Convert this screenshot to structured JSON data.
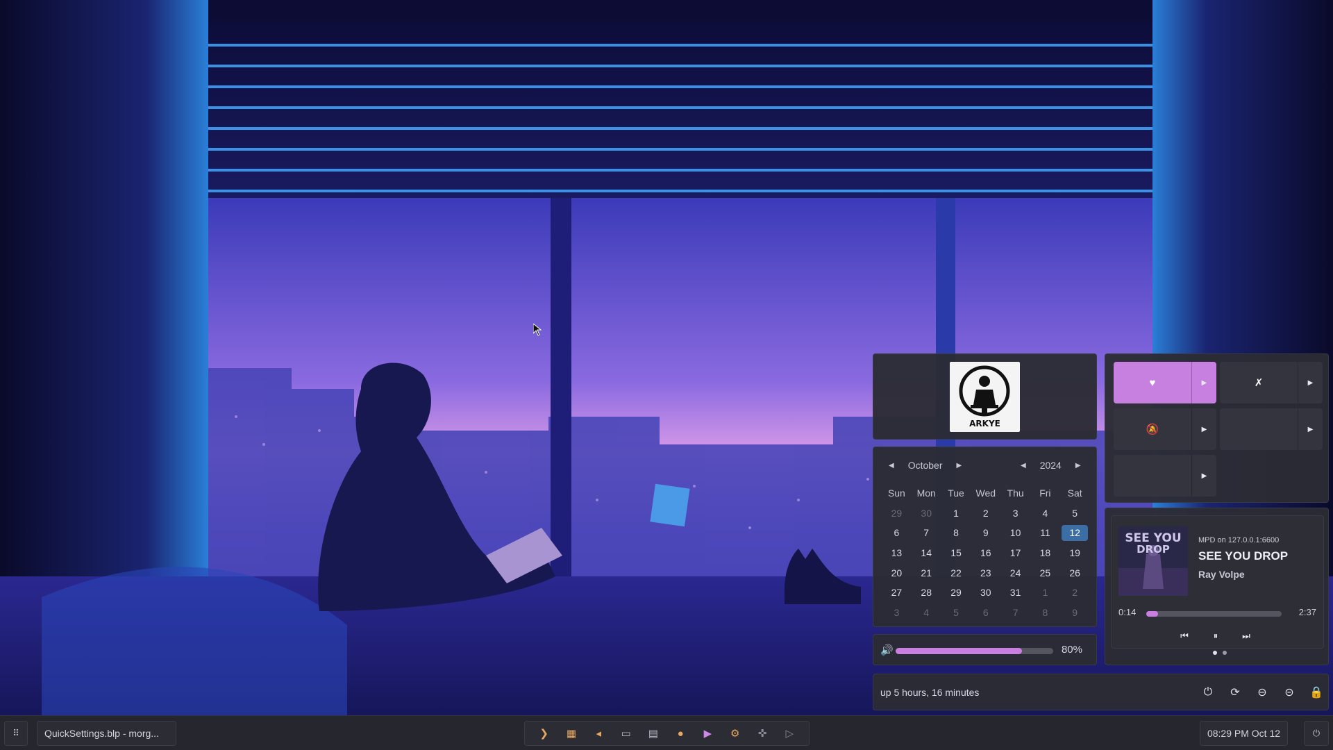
{
  "taskbar": {
    "active_window_title": "QuickSettings.blp - morg...",
    "clock": "08:29 PM Oct 12",
    "dock_icons": [
      "terminal-icon",
      "calendar-icon",
      "vscode-icon",
      "folder-icon",
      "text-editor-icon",
      "chat-icon",
      "youtube-icon",
      "settings-icon",
      "extensions-icon",
      "send-icon"
    ]
  },
  "profile": {
    "avatar_text": "ARKYE"
  },
  "calendar": {
    "month": "October",
    "year": "2024",
    "weekdays": [
      "Sun",
      "Mon",
      "Tue",
      "Wed",
      "Thu",
      "Fri",
      "Sat"
    ],
    "weeks": [
      [
        "29",
        "30",
        "1",
        "2",
        "3",
        "4",
        "5"
      ],
      [
        "6",
        "7",
        "8",
        "9",
        "10",
        "11",
        "12"
      ],
      [
        "13",
        "14",
        "15",
        "16",
        "17",
        "18",
        "19"
      ],
      [
        "20",
        "21",
        "22",
        "23",
        "24",
        "25",
        "26"
      ],
      [
        "27",
        "28",
        "29",
        "30",
        "31",
        "1",
        "2"
      ],
      [
        "3",
        "4",
        "5",
        "6",
        "7",
        "8",
        "9"
      ]
    ],
    "selected_day": "12"
  },
  "volume": {
    "level": 0.8,
    "label": "80%"
  },
  "uptime": {
    "text": "up 5 hours, 16 minutes"
  },
  "quick_toggles": {
    "wifi": {
      "on": true,
      "icon": "wifi-icon"
    },
    "bluetooth": {
      "on": false,
      "icon": "bluetooth-off-icon"
    },
    "notifications": {
      "on": false,
      "icon": "notifications-off-icon"
    },
    "toggle4": {
      "on": false
    },
    "toggle5": {
      "on": false
    }
  },
  "media": {
    "source": "MPD on 127.0.0.1:6600",
    "title": "SEE YOU DROP",
    "artist": "Ray Volpe",
    "position": "0:14",
    "length": "2:37",
    "progress": 0.089,
    "cover_text": "SEE YOU DROP"
  },
  "colors": {
    "accent": "#c77fe0",
    "today": "#3a6ea5",
    "panel": "#2c2c34"
  }
}
